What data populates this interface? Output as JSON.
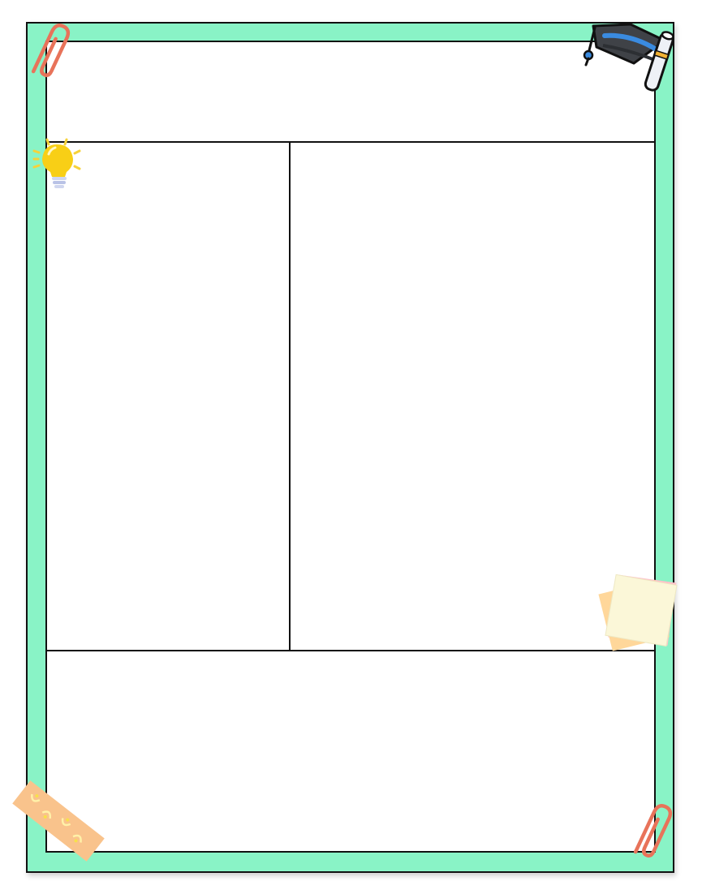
{
  "page": {
    "title": "",
    "cue_column_text": "",
    "notes_text": "",
    "summary_text": ""
  },
  "colors": {
    "frame": "#89f3c6",
    "sheet": "#ffffff",
    "lines": "#111111",
    "paperclip": "#e8735a",
    "tape": "#f9c38c"
  },
  "decorations": [
    "paperclip-icon",
    "graduation-cap-icon",
    "lightbulb-icon",
    "sticky-notes-icon",
    "washi-tape-icon",
    "paperclip-icon"
  ]
}
